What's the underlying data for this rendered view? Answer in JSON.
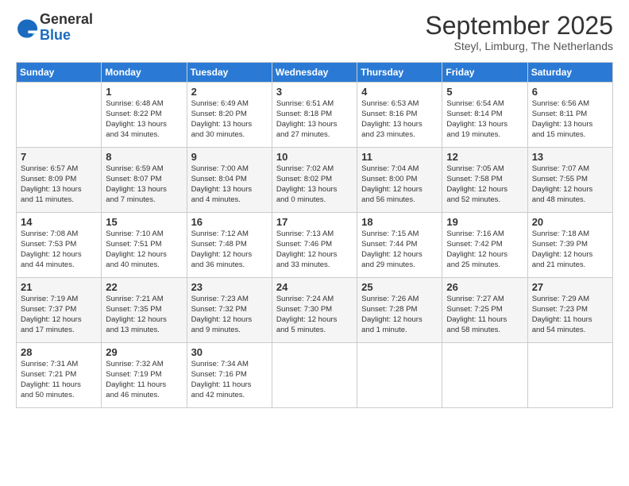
{
  "logo": {
    "general": "General",
    "blue": "Blue"
  },
  "header": {
    "month": "September 2025",
    "location": "Steyl, Limburg, The Netherlands"
  },
  "weekdays": [
    "Sunday",
    "Monday",
    "Tuesday",
    "Wednesday",
    "Thursday",
    "Friday",
    "Saturday"
  ],
  "weeks": [
    [
      {
        "day": "",
        "info": ""
      },
      {
        "day": "1",
        "info": "Sunrise: 6:48 AM\nSunset: 8:22 PM\nDaylight: 13 hours\nand 34 minutes."
      },
      {
        "day": "2",
        "info": "Sunrise: 6:49 AM\nSunset: 8:20 PM\nDaylight: 13 hours\nand 30 minutes."
      },
      {
        "day": "3",
        "info": "Sunrise: 6:51 AM\nSunset: 8:18 PM\nDaylight: 13 hours\nand 27 minutes."
      },
      {
        "day": "4",
        "info": "Sunrise: 6:53 AM\nSunset: 8:16 PM\nDaylight: 13 hours\nand 23 minutes."
      },
      {
        "day": "5",
        "info": "Sunrise: 6:54 AM\nSunset: 8:14 PM\nDaylight: 13 hours\nand 19 minutes."
      },
      {
        "day": "6",
        "info": "Sunrise: 6:56 AM\nSunset: 8:11 PM\nDaylight: 13 hours\nand 15 minutes."
      }
    ],
    [
      {
        "day": "7",
        "info": "Sunrise: 6:57 AM\nSunset: 8:09 PM\nDaylight: 13 hours\nand 11 minutes."
      },
      {
        "day": "8",
        "info": "Sunrise: 6:59 AM\nSunset: 8:07 PM\nDaylight: 13 hours\nand 7 minutes."
      },
      {
        "day": "9",
        "info": "Sunrise: 7:00 AM\nSunset: 8:04 PM\nDaylight: 13 hours\nand 4 minutes."
      },
      {
        "day": "10",
        "info": "Sunrise: 7:02 AM\nSunset: 8:02 PM\nDaylight: 13 hours\nand 0 minutes."
      },
      {
        "day": "11",
        "info": "Sunrise: 7:04 AM\nSunset: 8:00 PM\nDaylight: 12 hours\nand 56 minutes."
      },
      {
        "day": "12",
        "info": "Sunrise: 7:05 AM\nSunset: 7:58 PM\nDaylight: 12 hours\nand 52 minutes."
      },
      {
        "day": "13",
        "info": "Sunrise: 7:07 AM\nSunset: 7:55 PM\nDaylight: 12 hours\nand 48 minutes."
      }
    ],
    [
      {
        "day": "14",
        "info": "Sunrise: 7:08 AM\nSunset: 7:53 PM\nDaylight: 12 hours\nand 44 minutes."
      },
      {
        "day": "15",
        "info": "Sunrise: 7:10 AM\nSunset: 7:51 PM\nDaylight: 12 hours\nand 40 minutes."
      },
      {
        "day": "16",
        "info": "Sunrise: 7:12 AM\nSunset: 7:48 PM\nDaylight: 12 hours\nand 36 minutes."
      },
      {
        "day": "17",
        "info": "Sunrise: 7:13 AM\nSunset: 7:46 PM\nDaylight: 12 hours\nand 33 minutes."
      },
      {
        "day": "18",
        "info": "Sunrise: 7:15 AM\nSunset: 7:44 PM\nDaylight: 12 hours\nand 29 minutes."
      },
      {
        "day": "19",
        "info": "Sunrise: 7:16 AM\nSunset: 7:42 PM\nDaylight: 12 hours\nand 25 minutes."
      },
      {
        "day": "20",
        "info": "Sunrise: 7:18 AM\nSunset: 7:39 PM\nDaylight: 12 hours\nand 21 minutes."
      }
    ],
    [
      {
        "day": "21",
        "info": "Sunrise: 7:19 AM\nSunset: 7:37 PM\nDaylight: 12 hours\nand 17 minutes."
      },
      {
        "day": "22",
        "info": "Sunrise: 7:21 AM\nSunset: 7:35 PM\nDaylight: 12 hours\nand 13 minutes."
      },
      {
        "day": "23",
        "info": "Sunrise: 7:23 AM\nSunset: 7:32 PM\nDaylight: 12 hours\nand 9 minutes."
      },
      {
        "day": "24",
        "info": "Sunrise: 7:24 AM\nSunset: 7:30 PM\nDaylight: 12 hours\nand 5 minutes."
      },
      {
        "day": "25",
        "info": "Sunrise: 7:26 AM\nSunset: 7:28 PM\nDaylight: 12 hours\nand 1 minute."
      },
      {
        "day": "26",
        "info": "Sunrise: 7:27 AM\nSunset: 7:25 PM\nDaylight: 11 hours\nand 58 minutes."
      },
      {
        "day": "27",
        "info": "Sunrise: 7:29 AM\nSunset: 7:23 PM\nDaylight: 11 hours\nand 54 minutes."
      }
    ],
    [
      {
        "day": "28",
        "info": "Sunrise: 7:31 AM\nSunset: 7:21 PM\nDaylight: 11 hours\nand 50 minutes."
      },
      {
        "day": "29",
        "info": "Sunrise: 7:32 AM\nSunset: 7:19 PM\nDaylight: 11 hours\nand 46 minutes."
      },
      {
        "day": "30",
        "info": "Sunrise: 7:34 AM\nSunset: 7:16 PM\nDaylight: 11 hours\nand 42 minutes."
      },
      {
        "day": "",
        "info": ""
      },
      {
        "day": "",
        "info": ""
      },
      {
        "day": "",
        "info": ""
      },
      {
        "day": "",
        "info": ""
      }
    ]
  ]
}
